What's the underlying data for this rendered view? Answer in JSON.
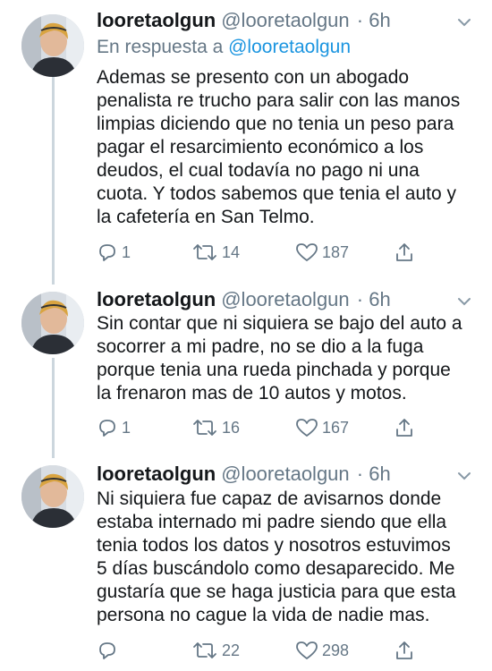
{
  "tweets": [
    {
      "name": "looretaolgun",
      "handle": "@looretaolgun",
      "time": "· 6h",
      "reply_prefix": "En respuesta a",
      "reply_handle": "@looretaolgun",
      "lines": [
        "Ademas se presento con un abogado",
        "penalista re trucho para salir con las manos",
        "limpias diciendo que no tenia un peso para",
        "pagar el resarcimiento económico a los",
        "deudos, el cual todavía no pago ni una",
        "cuota. Y todos sabemos que tenia el auto y",
        "la cafetería en San Telmo."
      ],
      "replies": "1",
      "retweets": "14",
      "likes": "187"
    },
    {
      "name": "looretaolgun",
      "handle": "@looretaolgun",
      "time": "· 6h",
      "lines": [
        "Sin contar que ni siquiera se bajo del auto a",
        "socorrer a mi padre, no se dio a la fuga",
        "porque tenia una rueda pinchada y porque",
        "la frenaron mas de 10 autos y motos."
      ],
      "replies": "1",
      "retweets": "16",
      "likes": "167"
    },
    {
      "name": "looretaolgun",
      "handle": "@looretaolgun",
      "time": "· 6h",
      "lines": [
        "Ni siquiera fue capaz de avisarnos donde",
        "estaba internado mi padre siendo que ella",
        "tenia todos los datos y nosotros estuvimos",
        "5 días buscándolo como desaparecido. Me",
        "gustaría que se haga justicia para que esta",
        "persona no cague la vida de nadie mas."
      ],
      "replies": "",
      "retweets": "22",
      "likes": "298"
    }
  ],
  "icons": {
    "reply": "reply-icon",
    "retweet": "retweet-icon",
    "like": "heart-icon",
    "share": "share-icon",
    "more": "chevron-down-icon"
  },
  "colors": {
    "text": "#14171a",
    "secondary": "#657786",
    "link": "#1b95e0",
    "thread_line": "#ccd6dd"
  }
}
